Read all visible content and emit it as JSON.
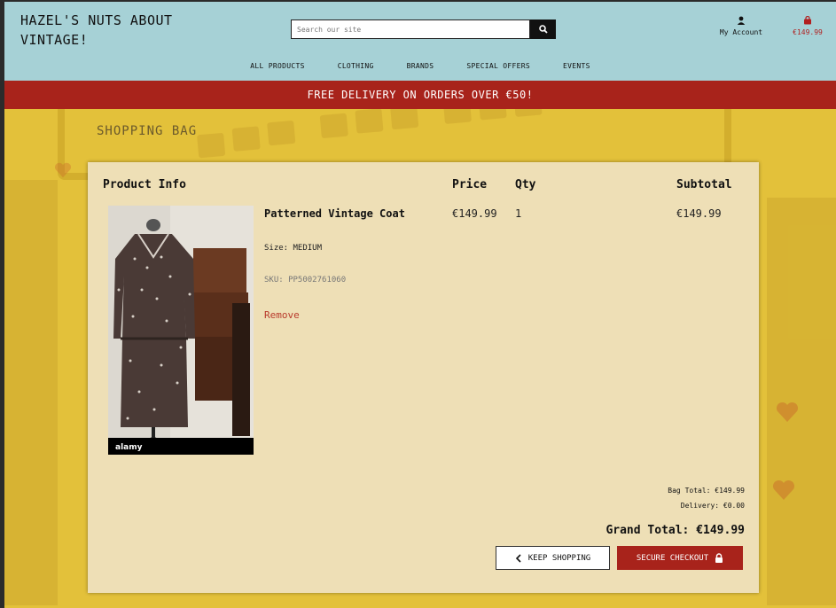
{
  "header": {
    "brand": "HAZEL'S NUTS ABOUT VINTAGE!",
    "search_placeholder": "Search our site",
    "account_label": "My Account",
    "bag_total": "€149.99"
  },
  "nav": {
    "items": [
      "ALL PRODUCTS",
      "CLOTHING",
      "BRANDS",
      "SPECIAL OFFERS",
      "EVENTS"
    ]
  },
  "banner": {
    "text": "FREE DELIVERY ON ORDERS OVER €50!"
  },
  "page": {
    "title": "SHOPPING BAG"
  },
  "table": {
    "headers": {
      "product": "Product Info",
      "price": "Price",
      "qty": "Qty",
      "subtotal": "Subtotal"
    },
    "rows": [
      {
        "name": "Patterned Vintage Coat",
        "size": "Size: MEDIUM",
        "sku": "SKU: PP5002761060",
        "remove": "Remove",
        "price": "€149.99",
        "qty": "1",
        "subtotal": "€149.99",
        "image_watermark": "alamy"
      }
    ]
  },
  "summary": {
    "bag_total": "Bag Total: €149.99",
    "delivery": "Delivery: €0.00",
    "grand_total": "Grand Total: €149.99"
  },
  "actions": {
    "keep_shopping": "KEEP SHOPPING",
    "secure_checkout": "SECURE CHECKOUT"
  },
  "colors": {
    "header_bg": "#a6d1d6",
    "banner_bg": "#a8231b",
    "card_bg": "#eedfb6",
    "page_bg": "#e3c13a"
  },
  "icons": {
    "search": "search-icon",
    "account": "user-icon",
    "bag": "shopping-bag-icon",
    "back": "chevron-left-icon",
    "lock": "lock-icon"
  }
}
